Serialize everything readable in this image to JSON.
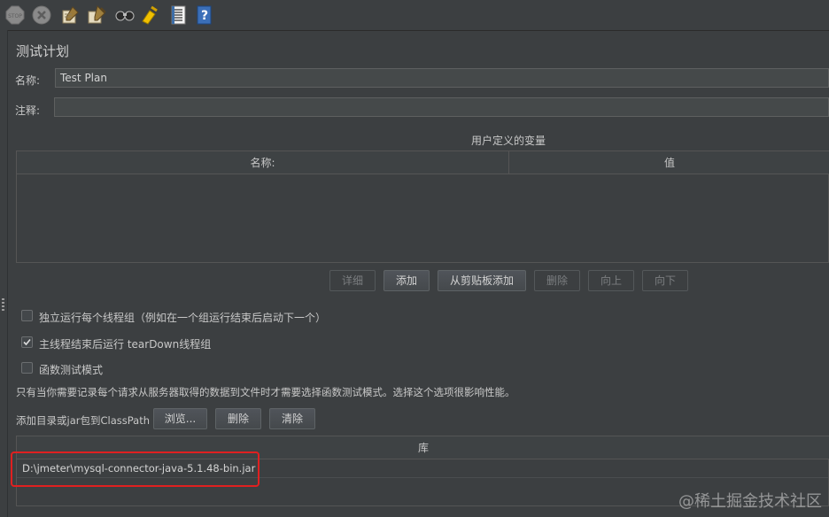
{
  "toolbar": {
    "icons": [
      "stop-icon",
      "shutdown-icon",
      "clear-icon",
      "clear-all-icon",
      "search-icon",
      "reset-search-icon",
      "function-helper-icon",
      "help-icon"
    ]
  },
  "panel": {
    "title": "测试计划",
    "name_label": "名称:",
    "name_value": "Test Plan",
    "comment_label": "注释:",
    "comment_value": ""
  },
  "user_vars": {
    "caption": "用户定义的变量",
    "columns": [
      "名称:",
      "值"
    ],
    "rows": []
  },
  "var_buttons": {
    "detail": "详细",
    "add": "添加",
    "add_from_clipboard": "从剪贴板添加",
    "delete": "删除",
    "up": "向上",
    "down": "向下"
  },
  "options": {
    "serialize": {
      "label": "独立运行每个线程组（例如在一个组运行结束后启动下一个）",
      "checked": false
    },
    "teardown": {
      "label": "主线程结束后运行 tearDown线程组",
      "checked": true
    },
    "functional": {
      "label": "函数测试模式",
      "checked": false
    },
    "functional_note": "只有当你需要记录每个请求从服务器取得的数据到文件时才需要选择函数测试模式。选择这个选项很影响性能。"
  },
  "classpath": {
    "label": "添加目录或jar包到ClassPath",
    "browse": "浏览...",
    "delete": "删除",
    "clear": "清除",
    "column": "库",
    "rows": [
      "D:\\jmeter\\mysql-connector-java-5.1.48-bin.jar"
    ]
  },
  "watermark": "@稀土掘金技术社区",
  "colors": {
    "background": "#3c3f41",
    "field": "#45494a",
    "highlight": "#e02020"
  }
}
